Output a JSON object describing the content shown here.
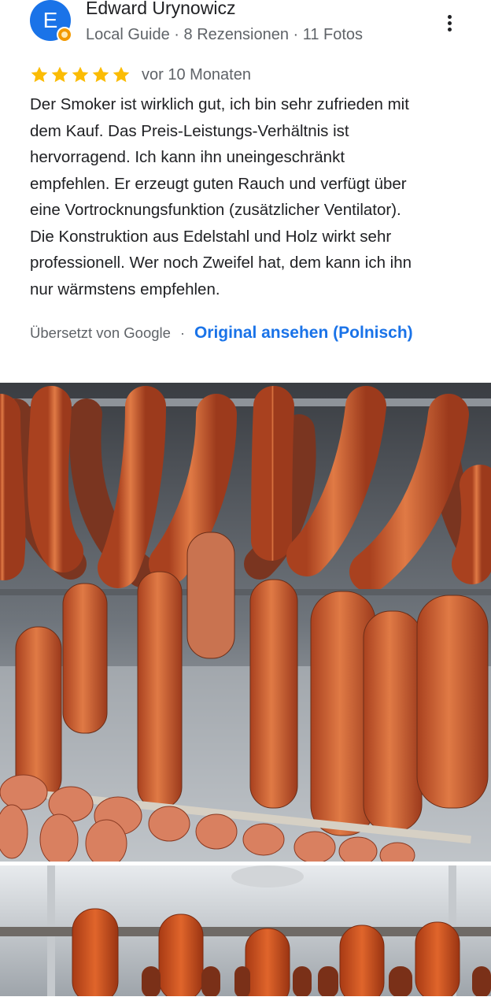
{
  "reviewer": {
    "avatar_letter": "E",
    "name": "Edward Urynowicz",
    "meta": "Local Guide · 8 Rezensionen · 11 Fotos",
    "avatar_color": "#1a73e8",
    "badge_color": "#f29900"
  },
  "menu": {
    "icon": "more-vertical-icon"
  },
  "rating": {
    "stars": 5,
    "max_stars": 5,
    "star_color": "#fbbc04",
    "age": "vor 10 Monaten"
  },
  "review": {
    "lines": [
      "Der Smoker ist wirklich gut, ich bin sehr zufrieden mit",
      "dem Kauf. Das Preis-Leistungs-Verhältnis ist",
      "hervorragend. Ich kann ihn uneingeschränkt",
      "empfehlen. Er erzeugt guten Rauch und verfügt über",
      "eine Vortrocknungsfunktion (zusätzlicher Ventilator).",
      "Die Konstruktion aus Edelstahl und Holz wirkt sehr",
      "professionell. Wer noch Zweifel hat, dem kann ich ihn",
      "nur wärmstens empfehlen."
    ]
  },
  "translation": {
    "label": "Übersetzt von Google",
    "separator": "·",
    "link": "Original ansehen (Polnisch)",
    "link_color": "#1a73e8"
  },
  "photos": [
    {
      "icon": "review-photo-sausages-in-smoker"
    },
    {
      "icon": "review-photo-sausages-on-rod"
    }
  ]
}
